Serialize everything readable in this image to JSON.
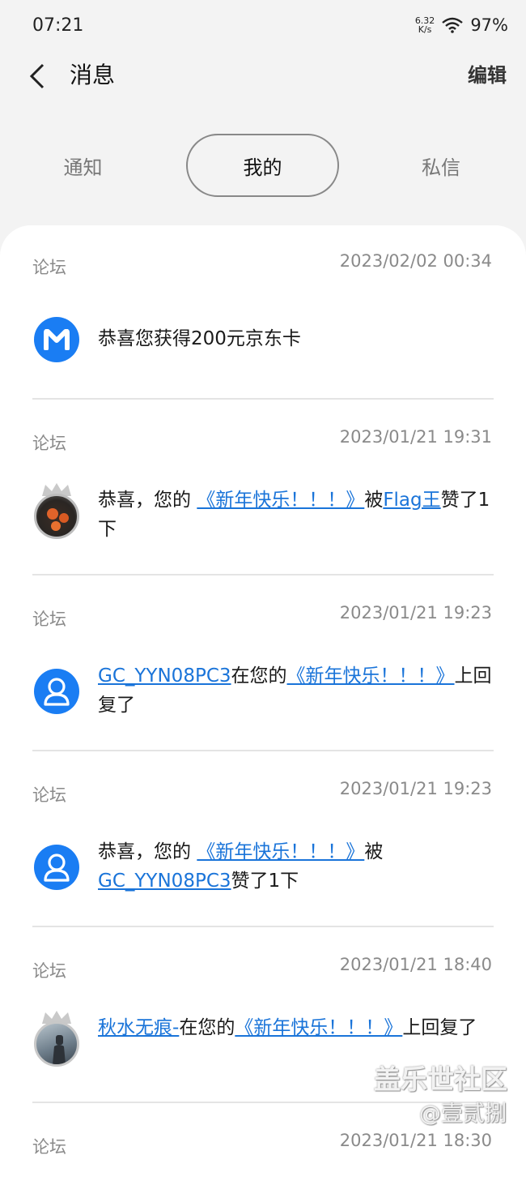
{
  "status_bar": {
    "time": "07:21",
    "net_speed_value": "6.32",
    "net_speed_unit": "K/s",
    "battery": "97%"
  },
  "app_bar": {
    "title": "消息",
    "edit_label": "编辑"
  },
  "tabs": [
    {
      "label": "通知",
      "selected": false
    },
    {
      "label": "我的",
      "selected": true
    },
    {
      "label": "私信",
      "selected": false
    }
  ],
  "messages": [
    {
      "category": "论坛",
      "time": "2023/02/02 00:34",
      "avatar": "m-logo-icon",
      "parts": [
        {
          "t": "恭喜您获得200元京东卡",
          "link": false
        }
      ]
    },
    {
      "category": "论坛",
      "time": "2023/01/21 19:31",
      "avatar": "user-photo",
      "parts": [
        {
          "t": "恭喜，您的 ",
          "link": false
        },
        {
          "t": "《新年快乐！！！》",
          "link": true
        },
        {
          "t": "被",
          "link": false
        },
        {
          "t": "Flag王",
          "link": true
        },
        {
          "t": "赞了1下",
          "link": false
        }
      ]
    },
    {
      "category": "论坛",
      "time": "2023/01/21 19:23",
      "avatar": "default-user-icon",
      "parts": [
        {
          "t": "GC_YYN08PC3",
          "link": true
        },
        {
          "t": "在您的",
          "link": false
        },
        {
          "t": "《新年快乐！！！》",
          "link": true
        },
        {
          "t": "上回复了",
          "link": false
        }
      ]
    },
    {
      "category": "论坛",
      "time": "2023/01/21 19:23",
      "avatar": "default-user-icon",
      "parts": [
        {
          "t": "恭喜，您的 ",
          "link": false
        },
        {
          "t": "《新年快乐！！！》",
          "link": true
        },
        {
          "t": "被",
          "link": false
        },
        {
          "t": "GC_YYN08PC3",
          "link": true
        },
        {
          "t": "赞了1下",
          "link": false
        }
      ]
    },
    {
      "category": "论坛",
      "time": "2023/01/21 18:40",
      "avatar": "user-photo",
      "parts": [
        {
          "t": "秋水无痕-",
          "link": true
        },
        {
          "t": "在您的",
          "link": false
        },
        {
          "t": "《新年快乐！！！》",
          "link": true
        },
        {
          "t": "上回复了",
          "link": false
        }
      ]
    },
    {
      "category": "论坛",
      "time": "2023/01/21 18:30",
      "avatar": "user-photo",
      "parts": []
    }
  ],
  "watermark": {
    "line1": "盖乐世社区",
    "line2": "@壹贰捌"
  },
  "colors": {
    "link": "#1a74d9",
    "avatar_blue": "#1a7df3",
    "background": "#f3f3f3"
  }
}
